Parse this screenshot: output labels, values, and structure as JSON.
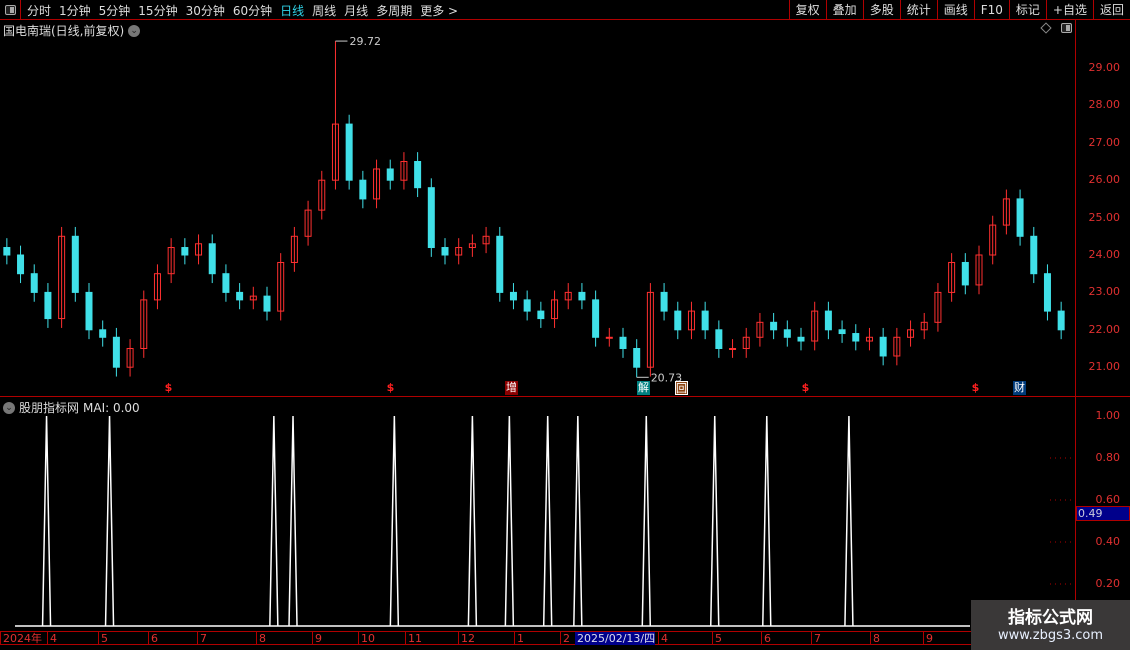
{
  "toolbar": {
    "periods": [
      "分时",
      "1分钟",
      "5分钟",
      "15分钟",
      "30分钟",
      "60分钟",
      "日线",
      "周线",
      "月线",
      "多周期",
      "更多 >"
    ],
    "active": "日线",
    "right_buttons": [
      "复权",
      "叠加",
      "多股",
      "统计",
      "画线",
      "F10",
      "标记",
      "+自选",
      "返回"
    ]
  },
  "chart_title": "国电南瑞(日线,前复权)",
  "indicator": {
    "name": "股朋指标网",
    "value_label": "MAI: 0.00",
    "cursor_value": "0.49"
  },
  "colors": {
    "up": "#ff3030",
    "down": "#40e0e8",
    "axis": "#b00000",
    "indicator_line": "#ffffff"
  },
  "chart_data": [
    {
      "type": "candlestick",
      "y_axis_ticks": [
        "29.00",
        "28.00",
        "27.00",
        "26.00",
        "25.00",
        "24.00",
        "23.00",
        "22.00",
        "21.00"
      ],
      "ylim": [
        20.5,
        30.0
      ],
      "closes": [
        24.0,
        23.5,
        23.0,
        22.3,
        24.5,
        23.0,
        22.0,
        21.8,
        21.0,
        21.5,
        22.8,
        23.5,
        24.2,
        24.0,
        24.3,
        23.5,
        23.0,
        22.8,
        22.9,
        22.5,
        23.8,
        24.5,
        25.2,
        26.0,
        27.5,
        26.0,
        25.5,
        26.3,
        26.0,
        26.5,
        25.8,
        24.2,
        24.0,
        24.2,
        24.3,
        24.5,
        23.0,
        22.8,
        22.5,
        22.3,
        22.8,
        23.0,
        22.8,
        21.8,
        21.8,
        21.5,
        21.0,
        23.0,
        22.5,
        22.0,
        22.5,
        22.0,
        21.5,
        21.5,
        21.8,
        22.2,
        22.0,
        21.8,
        21.7,
        22.5,
        22.0,
        21.9,
        21.7,
        21.8,
        21.3,
        21.8,
        22.0,
        22.2,
        23.0,
        23.8,
        23.2,
        24.0,
        24.8,
        25.5,
        24.5,
        23.5,
        22.5,
        22.0
      ],
      "annotations": [
        {
          "label": "29.72",
          "value": 29.72
        },
        {
          "label": "20.73",
          "value": 20.73
        }
      ],
      "events": [
        "$",
        "$",
        "增",
        "解",
        "回",
        "$",
        "$",
        "财"
      ]
    },
    {
      "type": "line",
      "y_axis_ticks": [
        "1.00",
        "0.80",
        "0.60",
        "0.40",
        "0.20"
      ],
      "ylim": [
        0,
        1.05
      ],
      "spike_bars": [
        3.4,
        8,
        20,
        21.4,
        28.8,
        34.5,
        37.2,
        40,
        42.2,
        47.2,
        52.2,
        56,
        62
      ],
      "baseline": 0,
      "peak": 1.0
    }
  ],
  "date_axis": {
    "labels": [
      "2024年",
      "4",
      "5",
      "6",
      "7",
      "8",
      "9",
      "10",
      "11",
      "12",
      "1",
      "2",
      "2025/02/13/四",
      "4",
      "5",
      "6",
      "7",
      "8",
      "9"
    ]
  },
  "watermark": {
    "line1": "指标公式网",
    "line2": "www.zbgs3.com"
  }
}
